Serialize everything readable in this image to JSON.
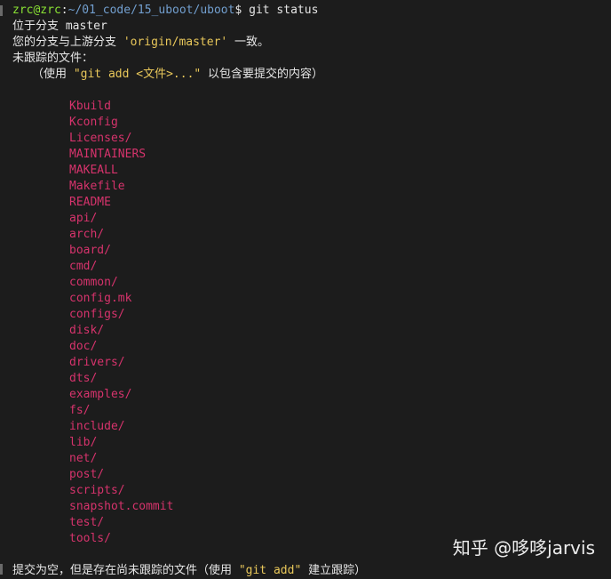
{
  "prompt": {
    "user_host": "zrc@zrc",
    "separator": ":",
    "path": "~/01_code/15_uboot/uboot",
    "dollar": "$",
    "command": " git status"
  },
  "status": {
    "branch_line": "位于分支 master",
    "upstream_prefix": "您的分支与上游分支 ",
    "upstream_name": "'origin/master'",
    "upstream_suffix": " 一致。",
    "untracked_header": "未跟踪的文件：",
    "hint_prefix": "（使用 ",
    "hint_cmd": "\"git add <文件>...\"",
    "hint_suffix": " 以包含要提交的内容）",
    "footer_prefix": "提交为空，但是存在尚未跟踪的文件（使用 ",
    "footer_cmd": "\"git add\"",
    "footer_suffix": " 建立跟踪）"
  },
  "untracked_files": [
    "Kbuild",
    "Kconfig",
    "Licenses/",
    "MAINTAINERS",
    "MAKEALL",
    "Makefile",
    "README",
    "api/",
    "arch/",
    "board/",
    "cmd/",
    "common/",
    "config.mk",
    "configs/",
    "disk/",
    "doc/",
    "drivers/",
    "dts/",
    "examples/",
    "fs/",
    "include/",
    "lib/",
    "net/",
    "post/",
    "scripts/",
    "snapshot.commit",
    "test/",
    "tools/"
  ],
  "watermark": "知乎 @哆哆jarvis"
}
